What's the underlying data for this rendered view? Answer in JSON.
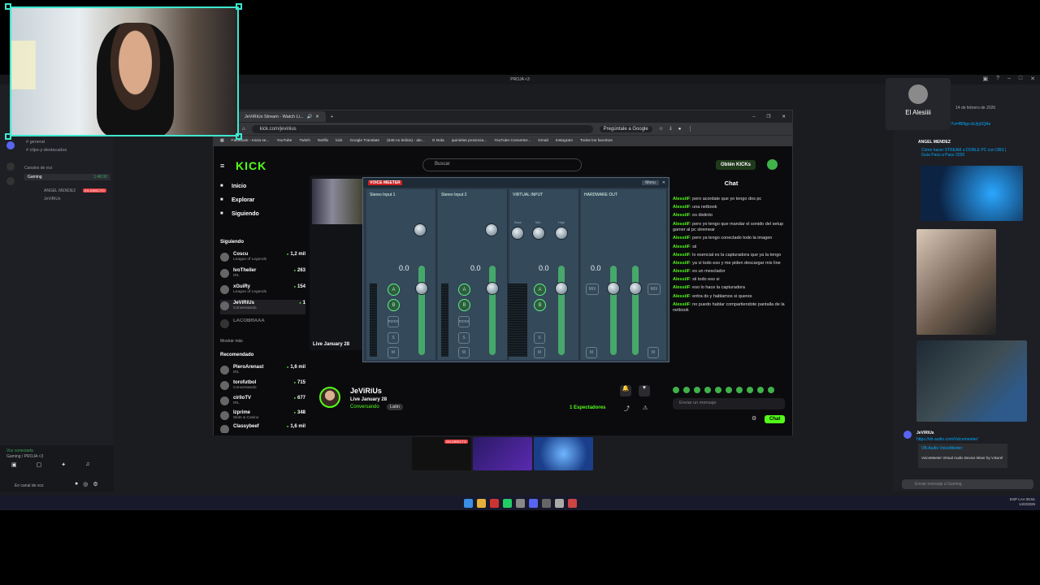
{
  "discord": {
    "window_title": "PROJA <3",
    "channels": [
      "general",
      "clips-y-destacados"
    ],
    "voice_section": "Canales de voz",
    "voice_channel": "Gaming",
    "voice_channel_time": "1:48:30",
    "voice_members": [
      "ANGEL MENDEZ",
      "JeViRiUs"
    ],
    "live_badge": "EN DIRECTO",
    "voice_status": "Voz conectada",
    "voice_location": "Gaming / PROJA <3",
    "user_status": "En canal de voz",
    "user_card_name": "El Alesiiii",
    "right_date": "14 de febrero de 2026",
    "right_link": "youtu.be/JR_8kwto?si=fBNgo-bUjrjUQAe",
    "right_author": "ANGEL MENDEZ",
    "right_video_title": "Cómo hacer STREAM a DOBLE PC con OBS | Guía Paso a Paso 2026",
    "right_msg_author": "JeViRiUs",
    "right_msg_link": "https://vb-audio.com/Voicemeeter/",
    "embed_title": "VB-Audio VoiceMeeter",
    "embed_desc": "VoiceMeeter Virtual Audio Device Mixer by V.Burel",
    "message_placeholder": "Enviar mensaje a Gaming"
  },
  "browser": {
    "tab_title": "JeViRiUs Stream - Watch Li...",
    "url": "kick.com/jeviriius",
    "ask_google": "Pregúntale a Google",
    "bookmarks": [
      "Facebook - Inicia se...",
      "YouTube",
      "Twitch",
      "Netflix",
      "kick",
      "Google Translate",
      "(545 no leídos) - ale...",
      "G Nola",
      "quinielas provincia...",
      "YouTube Converter...",
      "Gmail",
      "Instagram",
      "Todos los favoritos"
    ]
  },
  "kick": {
    "logo": "KICK",
    "search_placeholder": "Buscar",
    "get_kicks": "Obtén KICKs",
    "nav": [
      "Inicio",
      "Explorar",
      "Siguiendo"
    ],
    "following_title": "Siguiendo",
    "following": [
      {
        "name": "Coscu",
        "category": "League of Legends",
        "viewers": "1,2 mil"
      },
      {
        "name": "IvoTheiler",
        "category": "IRL",
        "viewers": "263"
      },
      {
        "name": "xGuiRy",
        "category": "League of Legends",
        "viewers": "154"
      },
      {
        "name": "JeViRiUs",
        "category": "Conversando",
        "viewers": "1"
      },
      {
        "name": "LACOBRAAA",
        "category": "",
        "viewers": ""
      }
    ],
    "show_more": "Mostrar más",
    "recommended_title": "Recomendado",
    "recommended": [
      {
        "name": "PieroArenast",
        "category": "IRL",
        "viewers": "1,6 mil"
      },
      {
        "name": "torofutbol",
        "category": "Conversando",
        "viewers": "715"
      },
      {
        "name": "cirlloTV",
        "category": "IRL",
        "viewers": "677"
      },
      {
        "name": "Izprime",
        "category": "Slots & Casino",
        "viewers": "348"
      },
      {
        "name": "Classybeef",
        "category": "",
        "viewers": "1,6 mil"
      }
    ],
    "live_label": "Live January 28",
    "streamer_name": "JeViRiUs",
    "stream_date": "Live January 28",
    "stream_category": "Conversando",
    "stream_lang": "Latin",
    "viewers_count": "1",
    "viewers_label": "Espectadores",
    "chat_title": "Chat",
    "chat_messages": [
      {
        "user": "AlessiiF",
        "text": "pero acordate que yo tengo dos pc"
      },
      {
        "user": "AlessiiF",
        "text": "una netbook"
      },
      {
        "user": "AlessiiF",
        "text": "es distinto"
      },
      {
        "user": "AlessiiF",
        "text": "pero yo tengo que mandar el sonido del setup gamer al pc stremear"
      },
      {
        "user": "AlessiiF",
        "text": "pero ya tengo conectado todo la imagen"
      },
      {
        "user": "AlessiiF",
        "text": "sii"
      },
      {
        "user": "AlessiiF",
        "text": "lo esencial es la capturadora que ya la tengo"
      },
      {
        "user": "AlessiiF",
        "text": "ya vi todo eso y me piden descargar mix line"
      },
      {
        "user": "AlessiiF",
        "text": "es un mesclador"
      },
      {
        "user": "AlessiiF",
        "text": "sii todo eso si"
      },
      {
        "user": "AlessiiF",
        "text": "eso lo hace la capturadora"
      },
      {
        "user": "AlessiiF",
        "text": "entra ds y hablamos si queres"
      },
      {
        "user": "AlessiiF",
        "text": "no puedo hablar compartiendote pantalla de la netbook"
      }
    ],
    "chat_placeholder": "Enviar un mensaje",
    "chat_button": "Chat"
  },
  "voicemeeter": {
    "title": "VOICE MEETER",
    "strips": [
      {
        "name": "Stereo Input 1",
        "value": "0.0"
      },
      {
        "name": "Stereo Input 2",
        "value": "0.0"
      },
      {
        "name": "VIRTUAL INPUT",
        "value": "0.0"
      },
      {
        "name": "HARDWARE OUT",
        "value": "0.0"
      }
    ],
    "menu": "Menu",
    "bus_a": "A",
    "bus_b": "B",
    "mono": "mono",
    "solo": "S",
    "mute": "M",
    "fader_label": "Fader Gain",
    "eq_labels": [
      "Bass",
      "Mid",
      "High"
    ],
    "mix_label": "MIX"
  },
  "taskbar": {
    "live_thumb_badge": "EN DIRECTO",
    "tray_lang": "ESP LAA",
    "time": "05:51",
    "date": "14/2/2026"
  }
}
